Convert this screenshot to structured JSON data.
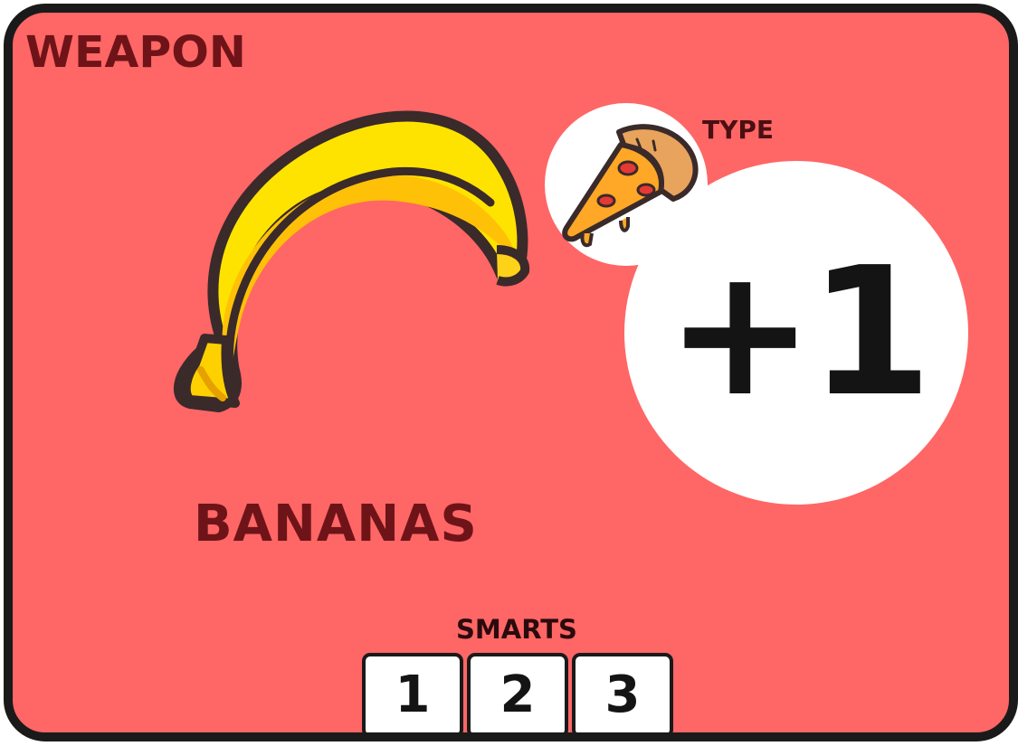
{
  "card": {
    "category": "WEAPON",
    "name": "BANANAS",
    "type_label": "TYPE",
    "type_icon": "pizza-slice-icon",
    "item_icon": "banana-icon",
    "bonus": "+1",
    "stat_label": "SMARTS",
    "stat_values": [
      "1",
      "2",
      "3"
    ],
    "colors": {
      "background": "#ff6666",
      "border": "#1a1a1a",
      "label_text": "#6e1418",
      "bonus_text": "#141414",
      "circle_fill": "#ffffff"
    }
  }
}
